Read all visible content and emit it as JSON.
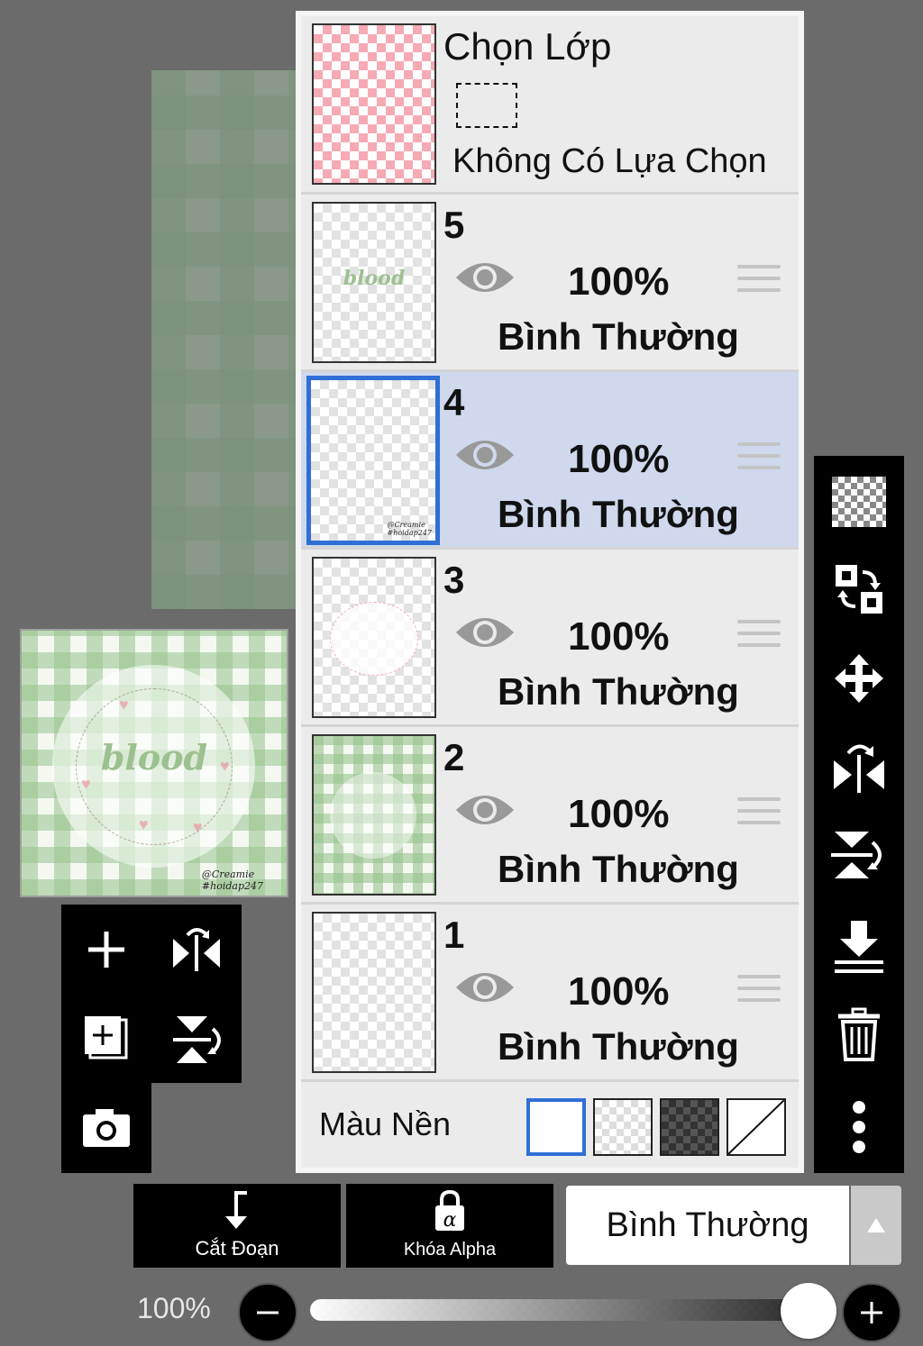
{
  "layers_panel": {
    "selection_layer": {
      "title": "Chọn Lớp",
      "subtitle": "Không Có Lựa Chọn"
    },
    "layers": [
      {
        "number": "5",
        "opacity": "100%",
        "blend": "Bình Thường",
        "selected": false,
        "thumb_text": "blood"
      },
      {
        "number": "4",
        "opacity": "100%",
        "blend": "Bình Thường",
        "selected": true,
        "thumb_text": ""
      },
      {
        "number": "3",
        "opacity": "100%",
        "blend": "Bình Thường",
        "selected": false,
        "thumb_text": ""
      },
      {
        "number": "2",
        "opacity": "100%",
        "blend": "Bình Thường",
        "selected": false,
        "thumb_text": ""
      },
      {
        "number": "1",
        "opacity": "100%",
        "blend": "Bình Thường",
        "selected": false,
        "thumb_text": ""
      }
    ],
    "background": {
      "label": "Màu Nền",
      "options": [
        "white",
        "checker-light",
        "checker-dark",
        "none"
      ],
      "selected": "white"
    }
  },
  "preview": {
    "word": "blood",
    "signature_line1": "@Creamie",
    "signature_line2": "#hoidap247"
  },
  "bottom_bar": {
    "clip_label": "Cắt Đoạn",
    "alpha_lock_label": "Khóa Alpha",
    "blend_mode": "Bình Thường",
    "opacity_label": "100%",
    "opacity_value": 1.0
  },
  "colors": {
    "selected_row": "#cfd8ec",
    "selected_border": "#2f6fd6",
    "panel": "#ebebeb",
    "toolbar": "#000000"
  }
}
